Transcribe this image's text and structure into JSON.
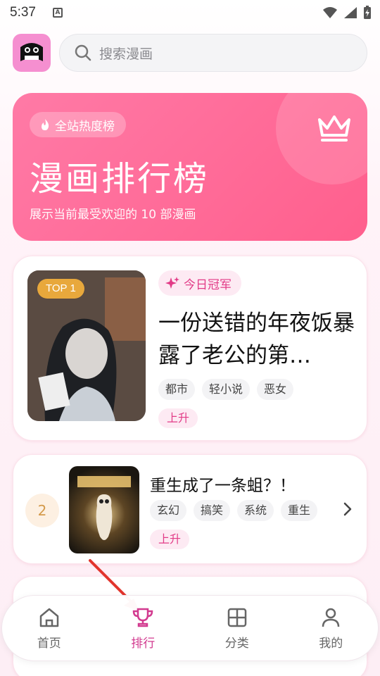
{
  "status": {
    "time": "5:37"
  },
  "header": {
    "search_placeholder": "搜索漫画"
  },
  "hero": {
    "badge": "全站热度榜",
    "title": "漫画排行榜",
    "subtitle": "展示当前最受欢迎的 10 部漫画"
  },
  "items": [
    {
      "rank_label": "TOP 1",
      "badge": "今日冠军",
      "title": "一份送错的年夜饭暴露了老公的第…",
      "tags": [
        "都市",
        "轻小说",
        "恶女"
      ],
      "trend": "上升"
    },
    {
      "rank_label": "2",
      "title": "重生成了一条蛆？！",
      "tags": [
        "玄幻",
        "搞笑",
        "系统",
        "重生"
      ],
      "trend": "上升"
    }
  ],
  "nav": [
    {
      "label": "首页",
      "icon": "home-icon"
    },
    {
      "label": "排行",
      "icon": "trophy-icon"
    },
    {
      "label": "分类",
      "icon": "grid-icon"
    },
    {
      "label": "我的",
      "icon": "user-icon"
    }
  ],
  "colors": {
    "accent": "#ff5f8d",
    "active": "#d23a8f",
    "gold": "#e8a83c"
  }
}
